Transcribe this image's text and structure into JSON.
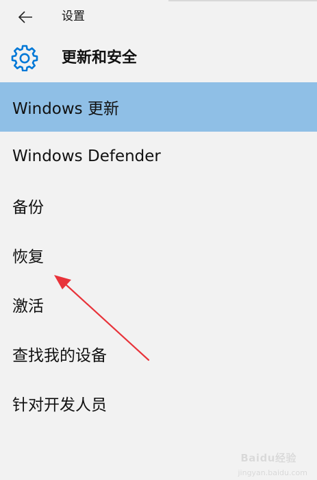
{
  "header": {
    "app_title": "设置",
    "back_icon": "back-arrow-icon"
  },
  "section": {
    "title": "更新和安全",
    "icon": "gear-icon"
  },
  "nav": {
    "items": [
      {
        "label": "Windows 更新",
        "selected": true
      },
      {
        "label": "Windows Defender",
        "selected": false
      },
      {
        "label": "备份",
        "selected": false
      },
      {
        "label": "恢复",
        "selected": false
      },
      {
        "label": "激活",
        "selected": false
      },
      {
        "label": "查找我的设备",
        "selected": false
      },
      {
        "label": "针对开发人员",
        "selected": false
      }
    ]
  },
  "colors": {
    "accent": "#0078d7",
    "selected_background": "#8fbfe6",
    "annotation_arrow": "#e8333a",
    "page_background": "#f2f2f2"
  },
  "watermark": {
    "text": "Baidu经验",
    "sub": "jingyan.baidu.com"
  }
}
